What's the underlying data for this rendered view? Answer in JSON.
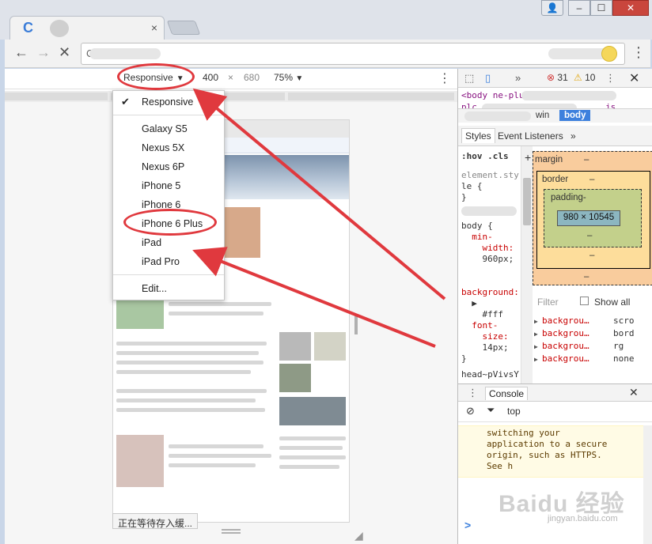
{
  "browser": {
    "tab_favicon": "C",
    "tab_title": "",
    "tab_close": "×",
    "window_buttons": {
      "user": "👤",
      "minimize": "–",
      "maximize": "☐",
      "close": "✕"
    },
    "back": "←",
    "forward": "→",
    "stop": "✕",
    "omnibox_prefix": "C",
    "menu": "⋮"
  },
  "device_toolbar": {
    "device": "Responsive",
    "width": "400",
    "times": "×",
    "height": "680",
    "zoom": "75%",
    "more": "⋮"
  },
  "dropdown": {
    "items": [
      "Responsive",
      "Galaxy S5",
      "Nexus 5X",
      "Nexus 6P",
      "iPhone 5",
      "iPhone 6",
      "iPhone 6 Plus",
      "iPad",
      "iPad Pro",
      "Edit..."
    ],
    "checked": "Responsive",
    "check_mark": "✔"
  },
  "page_status": "正在等待存入缓...",
  "devtools": {
    "top": {
      "more_tabs": "»",
      "errors": "31",
      "warnings": "10",
      "close": "✕"
    },
    "elements": {
      "line1": "<body ne-plu",
      "line2": "plc",
      "line2b": "js",
      "crumb_win": "win",
      "crumb_body": "body"
    },
    "style_tabs": [
      "Styles",
      "Event Listeners",
      "»"
    ],
    "styles_lines": [
      ":hov .cls",
      "element.sty",
      "le {",
      "}",
      "body {",
      "  min-",
      "    width:",
      "    960px;",
      "background:",
      "  ▶",
      "    #fff",
      "  font-",
      "    size:",
      "    14px;",
      "}",
      "head~pVivsY"
    ],
    "box_model": {
      "margin_label": "margin",
      "margin_value": "–",
      "border_label": "border",
      "border_value": "–",
      "padding_label": "padding-",
      "padding_value": "–",
      "content": "980 × 10545",
      "plus": "+"
    },
    "filter_placeholder": "Filter",
    "show_all": "Show all",
    "computed": [
      {
        "name": "backgrou…",
        "value": "scro"
      },
      {
        "name": "backgrou…",
        "value": "bord"
      },
      {
        "name": "backgrou…",
        "value": "rg"
      },
      {
        "name": "backgrou…",
        "value": "none"
      }
    ],
    "console": {
      "tab": "Console",
      "close": "✕",
      "context": "top",
      "message": [
        "switching your",
        "application to a secure",
        "origin, such as HTTPS.",
        "See h"
      ],
      "prompt": ">"
    }
  },
  "watermark": {
    "main": "Baidu 经验",
    "sub": "jingyan.baidu.com"
  },
  "colors": {
    "annotation": "#e0393e",
    "accent": "#3d80dd"
  }
}
